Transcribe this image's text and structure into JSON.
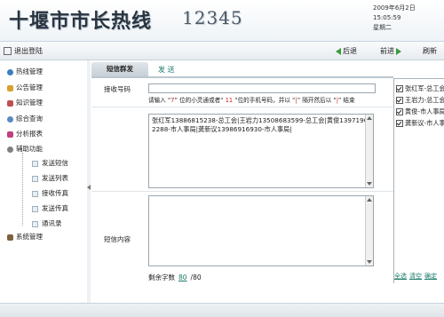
{
  "header": {
    "title": "十堰市市长热线",
    "hotline": "12345",
    "date": "2009年6月2日",
    "time": "15:05:59",
    "weekday": "星期二"
  },
  "toolbar": {
    "logout_label": "退出登陆",
    "back_label": "后退",
    "forward_label": "前进",
    "refresh_label": "刷新"
  },
  "sidebar": {
    "items": [
      {
        "label": "热线管理",
        "icon": "globe-icon",
        "color": "#3a7fc0"
      },
      {
        "label": "公告管理",
        "icon": "announcement-icon",
        "color": "#d8a030"
      },
      {
        "label": "知识管理",
        "icon": "book-icon",
        "color": "#c05050"
      },
      {
        "label": "综合查询",
        "icon": "search-icon",
        "color": "#5a8ac0"
      },
      {
        "label": "分析报表",
        "icon": "chart-icon",
        "color": "#c04080"
      },
      {
        "label": "辅助功能",
        "icon": "gear-icon",
        "color": "#808080"
      }
    ],
    "sub_items": [
      {
        "label": "发送短信"
      },
      {
        "label": "发送列表"
      },
      {
        "label": "接收传真"
      },
      {
        "label": "发送传真"
      },
      {
        "label": "通讯录"
      }
    ],
    "system": {
      "label": "系统管理",
      "icon": "tools-icon",
      "color": "#806040"
    }
  },
  "tabs": {
    "active": "短信群发",
    "send": "发 送"
  },
  "form": {
    "recipient_label": "接收号码",
    "recipient_value": "",
    "hint_parts": [
      "请输入 “",
      "7",
      "” 位的小灵通或者“ ",
      "11",
      " ”位的手机号码，并以 “",
      "|",
      "” 隔开然后以 “",
      "|",
      "” 结束"
    ],
    "recipients_text": "张红军13886815238-总工会|王岩力13508683599-总工会|黄俊13971902288-市人事局|龚新议13986916930-市人事局|",
    "content_label": "短信内容",
    "content_value": "",
    "remaining_label": "剩余字数",
    "remaining_count": "80",
    "max_count": "/80"
  },
  "right_panel": {
    "recipients": [
      {
        "label": "张红军-总工会",
        "checked": true
      },
      {
        "label": "王岩力-总工会",
        "checked": true
      },
      {
        "label": "黄俊-市人事局",
        "checked": true
      },
      {
        "label": "龚新议-市人事局",
        "checked": true
      }
    ],
    "select_all": "全选",
    "clear": "清空",
    "confirm": "确定"
  }
}
